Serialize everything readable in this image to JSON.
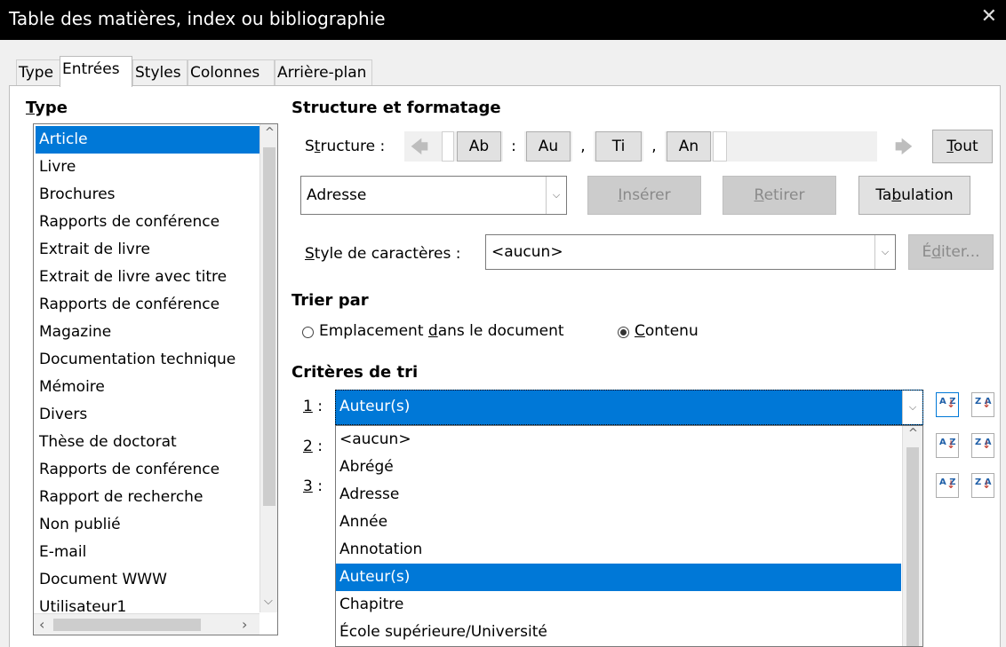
{
  "window": {
    "title": "Table des matières, index ou bibliographie",
    "close_glyph": "✕"
  },
  "tabs": [
    {
      "label": "Type"
    },
    {
      "label": "Entrées"
    },
    {
      "label": "Styles"
    },
    {
      "label": "Colonnes"
    },
    {
      "label": "Arrière-plan"
    }
  ],
  "type_section": {
    "heading_first": "T",
    "heading_rest": "ype",
    "items": [
      {
        "label": "Article",
        "selected": true
      },
      {
        "label": "Livre"
      },
      {
        "label": "Brochures"
      },
      {
        "label": "Rapports de conférence"
      },
      {
        "label": "Extrait de livre"
      },
      {
        "label": "Extrait de livre avec titre"
      },
      {
        "label": "Rapports de conférence"
      },
      {
        "label": "Magazine"
      },
      {
        "label": "Documentation technique"
      },
      {
        "label": "Mémoire"
      },
      {
        "label": "Divers"
      },
      {
        "label": "Thèse de doctorat"
      },
      {
        "label": "Rapports de conférence"
      },
      {
        "label": "Rapport de recherche"
      },
      {
        "label": "Non publié"
      },
      {
        "label": "E-mail"
      },
      {
        "label": "Document WWW"
      },
      {
        "label": "Utilisateur1"
      }
    ]
  },
  "structure": {
    "heading": "Structure et formatage",
    "label_pre": "S",
    "label_u": "t",
    "label_post": "ructure :",
    "tokens": [
      "Ab",
      ":",
      "Au",
      ",",
      "Ti",
      ",",
      "An"
    ],
    "tout_label": "T",
    "tout_rest": "out",
    "field_combo_value": "Adresse",
    "inserer_pre": "I",
    "inserer_rest": "nsérer",
    "retirer_pre": "R",
    "retirer_rest": "etirer",
    "tabulation_pre": "Ta",
    "tabulation_u": "b",
    "tabulation_post": "ulation",
    "char_style_u": "S",
    "char_style_rest": "tyle de caractères :",
    "char_style_value": "<aucun>",
    "editer_pre": "É",
    "editer_u": "d",
    "editer_post": "iter..."
  },
  "sort": {
    "heading": "Trier par",
    "option1_pre": "Emplacement ",
    "option1_u": "d",
    "option1_post": "ans le document",
    "option2_u": "C",
    "option2_post": "ontenu",
    "selected": "Contenu"
  },
  "criteria": {
    "heading": "Critères de tri",
    "rows": [
      {
        "num": "1",
        "suffix": " :",
        "value": "Auteur(s)"
      },
      {
        "num": "2",
        "suffix": " :"
      },
      {
        "num": "3",
        "suffix": " :"
      }
    ],
    "dropdown_options": [
      {
        "label": "<aucun>"
      },
      {
        "label": "Abrégé"
      },
      {
        "label": "Adresse"
      },
      {
        "label": "Année"
      },
      {
        "label": "Annotation"
      },
      {
        "label": "Auteur(s)",
        "selected": true
      },
      {
        "label": "Chapitre"
      },
      {
        "label": "École supérieure/Université"
      }
    ],
    "sort_asc_glyph": "A Z",
    "sort_desc_glyph": "Z A"
  },
  "colors": {
    "selection": "#0078d7",
    "titlebar": "#000000"
  },
  "icons": {
    "left_arrow": "🡄",
    "right_arrow": "🡆",
    "chevron_down": "⌵",
    "chevron_up": "^",
    "arrow_left_small": "‹",
    "arrow_right_small": "›"
  }
}
